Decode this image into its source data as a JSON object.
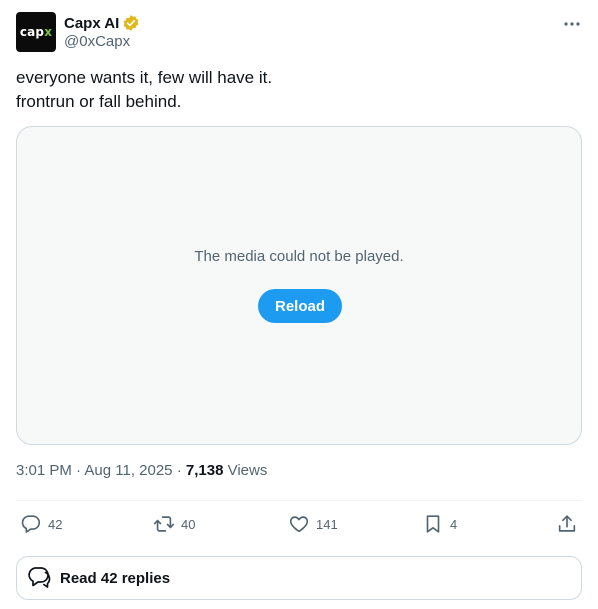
{
  "author": {
    "display_name": "Capx AI",
    "handle": "@0xCapx",
    "avatar_logo": {
      "part1": "cap",
      "part2": "x"
    },
    "verified_badge_color": "#e2b719"
  },
  "tweet": {
    "lines": [
      "everyone wants it, few will have it.",
      "frontrun or fall behind."
    ]
  },
  "media": {
    "message": "The media could not be played.",
    "reload_label": "Reload"
  },
  "meta": {
    "time": "3:01 PM",
    "separator1": " · ",
    "date": "Aug 11, 2025",
    "separator2": " · ",
    "views_count": "7,138",
    "views_label": "Views"
  },
  "actions": {
    "replies": "42",
    "reposts": "40",
    "likes": "141",
    "bookmarks": "4"
  },
  "read_replies": {
    "label": "Read 42 replies"
  },
  "icons": {
    "more": "more-horizontal-icon",
    "reply": "reply-bubble-icon",
    "repost": "repost-icon",
    "like": "heart-icon",
    "bookmark": "bookmark-icon",
    "share": "share-icon",
    "replies_bubble": "double-bubble-icon"
  },
  "colors": {
    "accent": "#1d9bf0",
    "text_primary": "#0f1419",
    "text_secondary": "#536471",
    "border": "#cfd9de"
  }
}
